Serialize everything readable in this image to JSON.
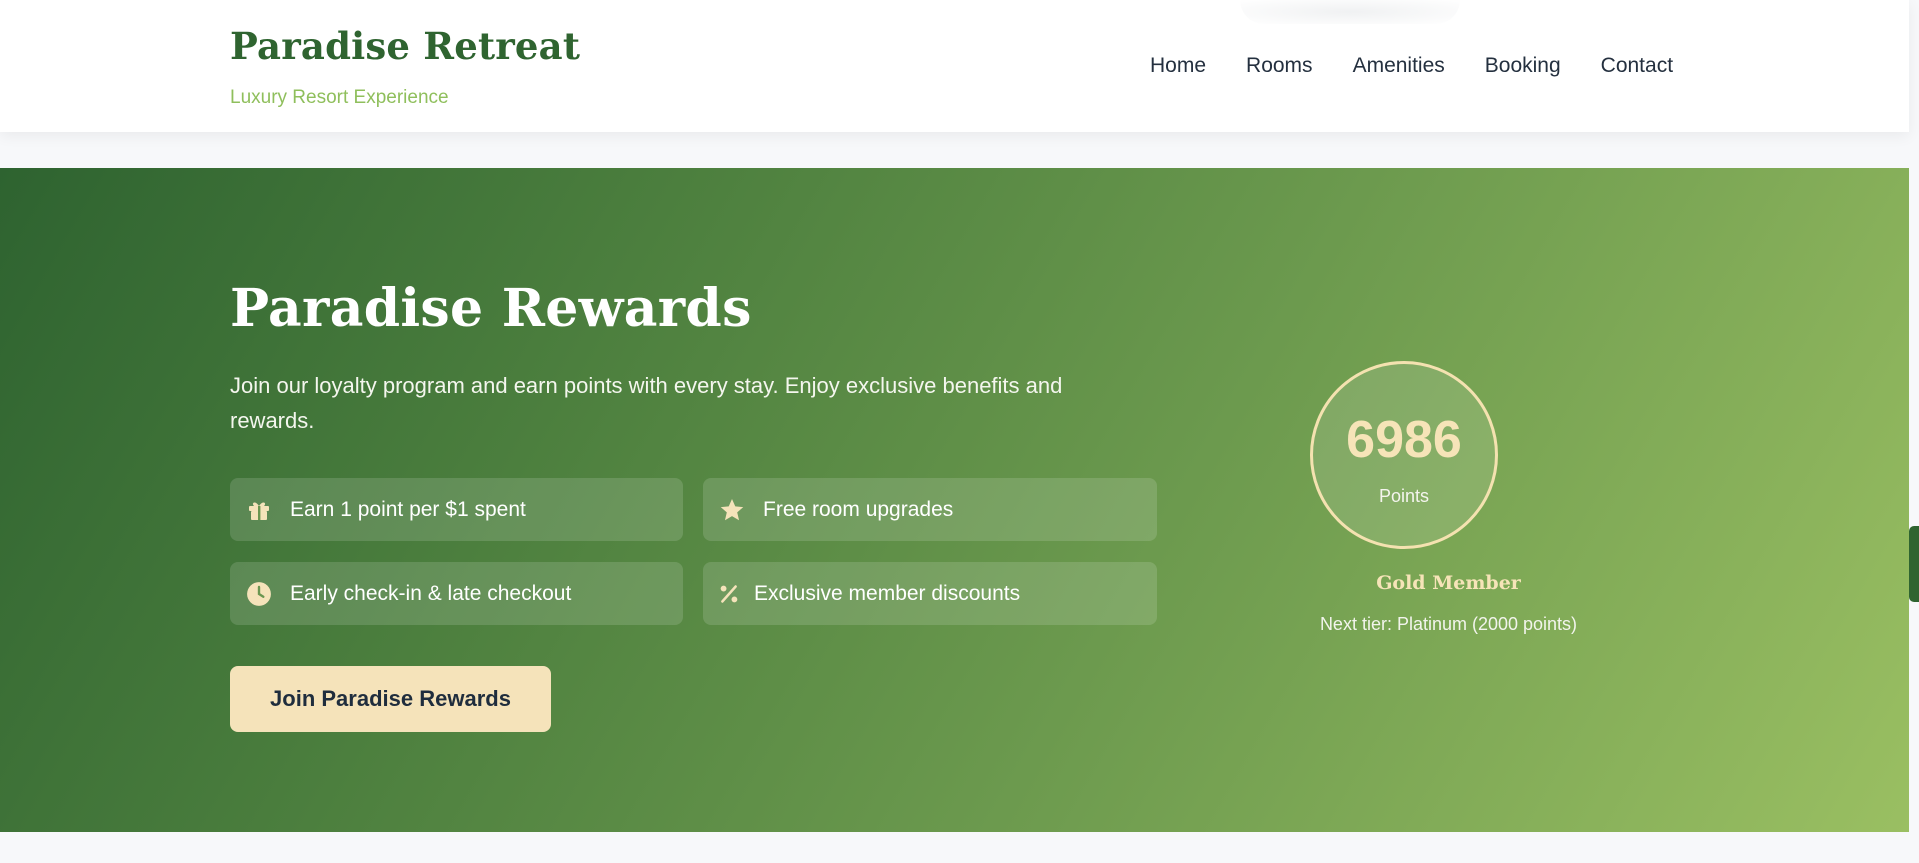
{
  "header": {
    "brand_title": "Paradise Retreat",
    "brand_subtitle": "Luxury Resort Experience",
    "nav": [
      "Home",
      "Rooms",
      "Amenities",
      "Booking",
      "Contact"
    ]
  },
  "rewards": {
    "title": "Paradise Rewards",
    "description": "Join our loyalty program and earn points with every stay. Enjoy exclusive benefits and rewards.",
    "benefits": [
      {
        "icon": "gift-icon",
        "label": "Earn 1 point per $1 spent"
      },
      {
        "icon": "star-icon",
        "label": "Free room upgrades"
      },
      {
        "icon": "clock-icon",
        "label": "Early check-in & late checkout"
      },
      {
        "icon": "percent-icon",
        "label": "Exclusive member discounts"
      }
    ],
    "join_button": "Join Paradise Rewards",
    "points": {
      "value": "6986",
      "label": "Points"
    },
    "tier": "Gold Member",
    "next_tier": "Next tier: Platinum (2000 points)"
  },
  "colors": {
    "brand_green": "#2f6430",
    "subtitle_green": "#8fbf5c",
    "accent_cream": "#f5e3ba",
    "gradient_start": "#2e6330",
    "gradient_end": "#9abf62"
  }
}
